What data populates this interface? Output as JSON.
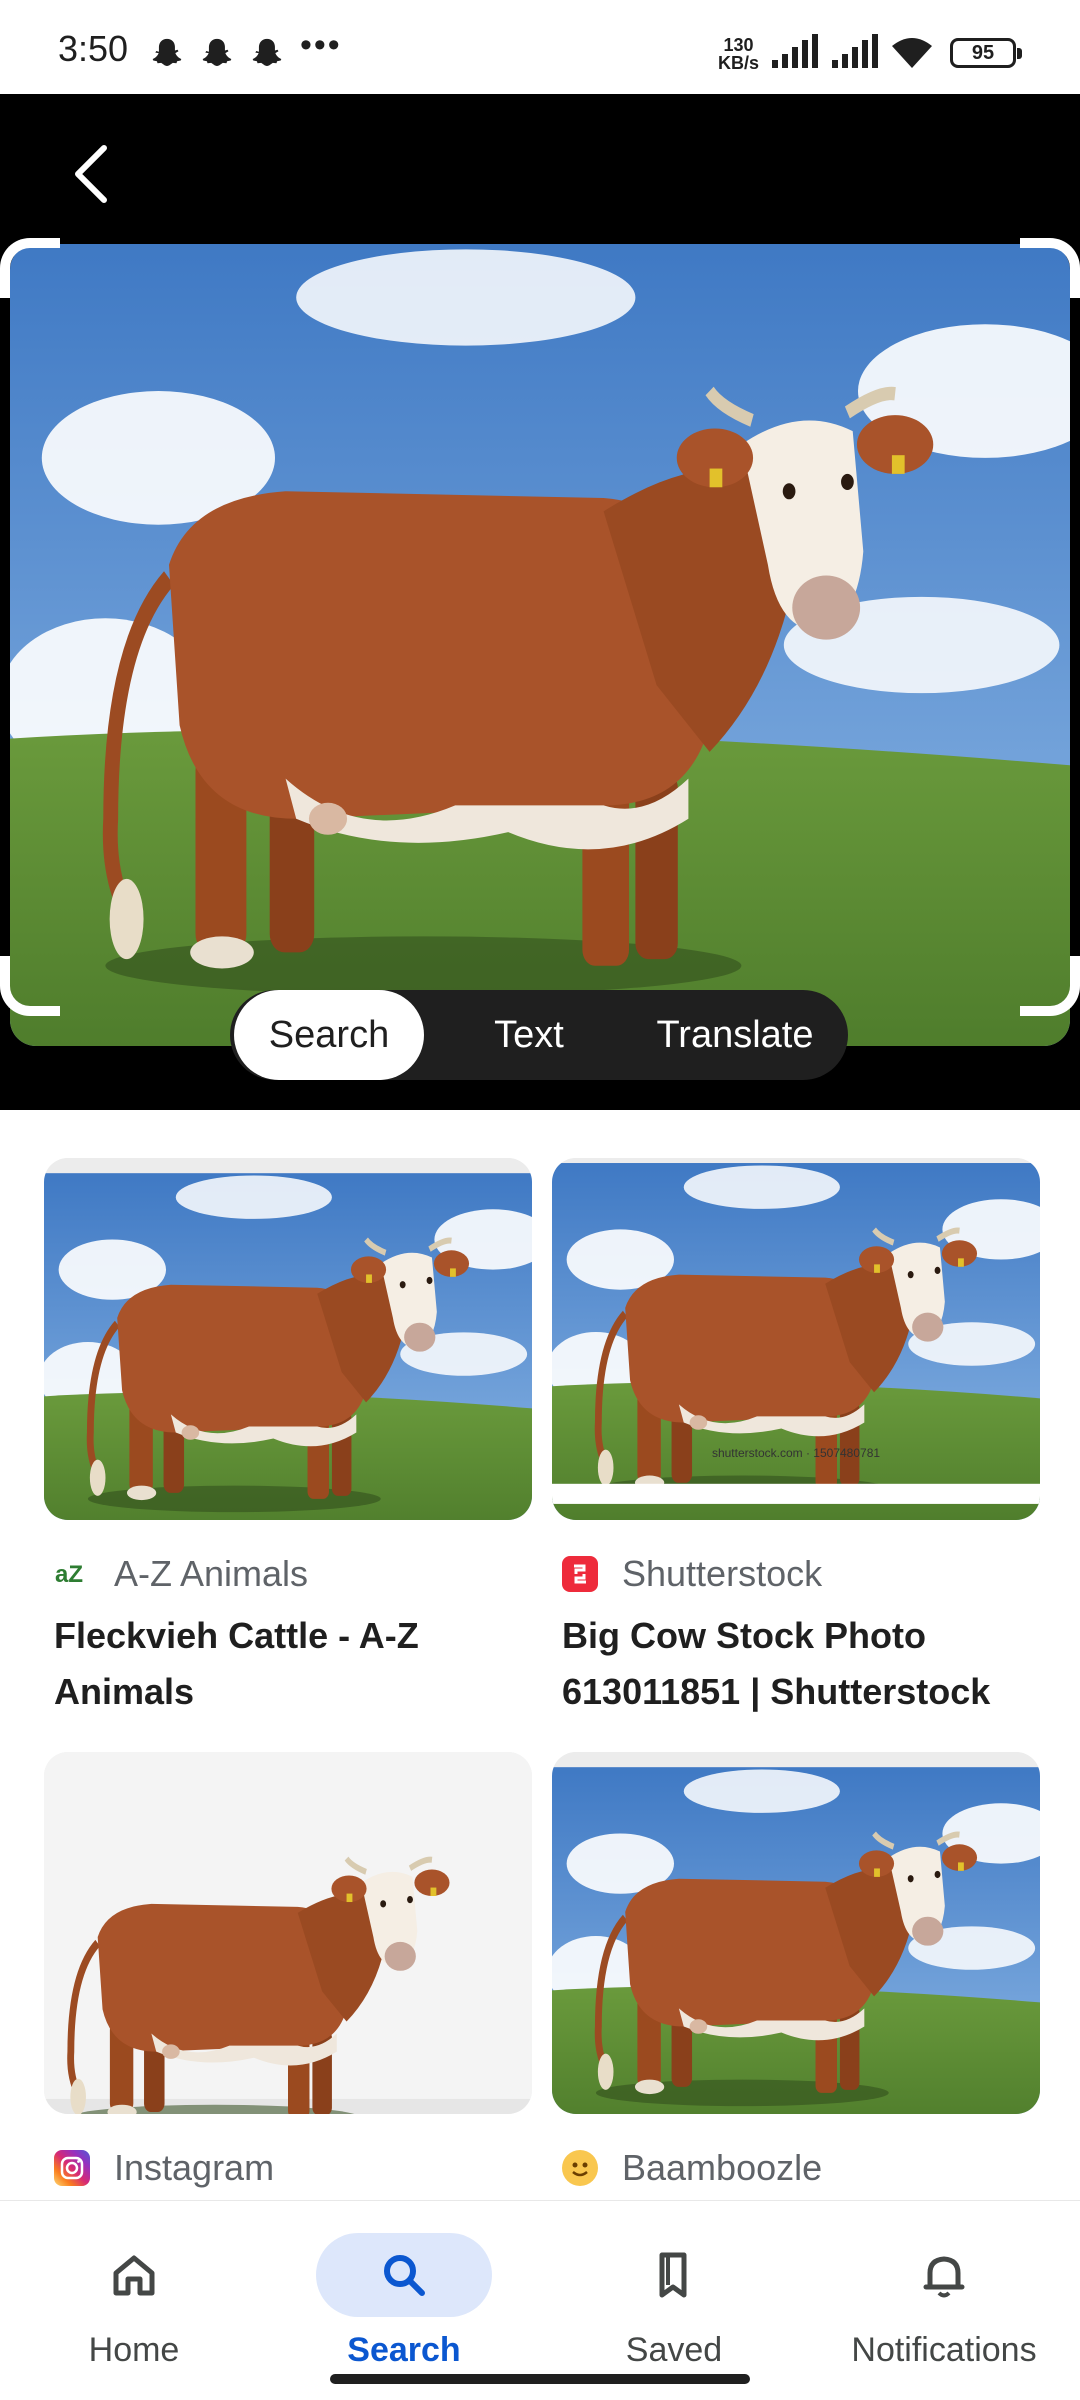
{
  "status_bar": {
    "time": "3:50",
    "dots": "•••",
    "net_speed_value": "130",
    "net_speed_unit": "KB/s",
    "battery": "95"
  },
  "viewer": {
    "back_icon": "chevron-left-icon",
    "modes": [
      {
        "label": "Search",
        "active": true
      },
      {
        "label": "Text",
        "active": false
      },
      {
        "label": "Translate",
        "active": false
      }
    ]
  },
  "results": [
    {
      "source": "A-Z Animals",
      "title": "Fleckvieh Cattle - A-Z Animals",
      "icon": "az-animals-icon",
      "icon_color": "#2e7d32"
    },
    {
      "source": "Shutterstock",
      "title": "Big Cow Stock Photo 613011851 | Shutterstock",
      "icon": "shutterstock-icon",
      "icon_color": "#ee2b3b",
      "watermark": "shutterstock.com · 1507480781"
    },
    {
      "source": "Instagram",
      "title": "",
      "icon": "instagram-icon",
      "icon_color": "#d62976"
    },
    {
      "source": "Baamboozle",
      "title": "",
      "icon": "baamboozle-icon",
      "icon_color": "#f9c74f"
    }
  ],
  "bottom_nav": [
    {
      "label": "Home",
      "icon": "home-icon",
      "active": false
    },
    {
      "label": "Search",
      "icon": "search-icon",
      "active": true
    },
    {
      "label": "Saved",
      "icon": "bookmark-icon",
      "active": false
    },
    {
      "label": "Notifications",
      "icon": "bell-icon",
      "active": false
    }
  ],
  "colors": {
    "accent": "#0b57d0",
    "nav_active_bg": "#dde7fb"
  }
}
